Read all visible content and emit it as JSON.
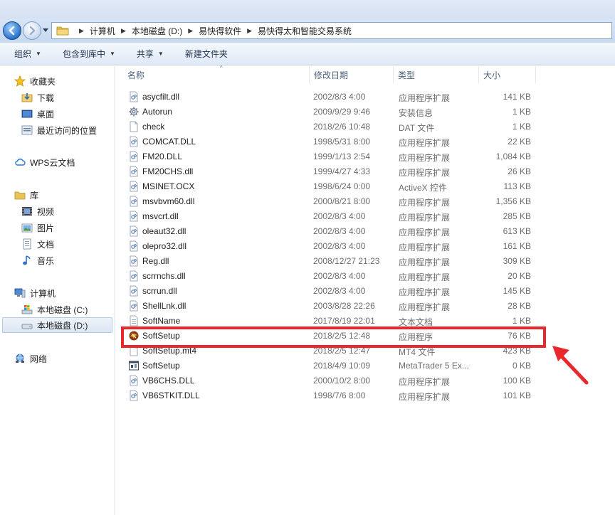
{
  "address": {
    "crumbs": [
      "计算机",
      "本地磁盘 (D:)",
      "易快得软件",
      "易快得太和智能交易系统"
    ]
  },
  "toolbar": {
    "organize": "组织",
    "include_library": "包含到库中",
    "share": "共享",
    "new_folder": "新建文件夹"
  },
  "sidebar": {
    "favorites": "收藏夹",
    "downloads": "下载",
    "desktop": "桌面",
    "recent": "最近访问的位置",
    "wps": "WPS云文档",
    "libraries": "库",
    "videos": "视频",
    "pictures": "图片",
    "documents": "文档",
    "music": "音乐",
    "computer": "计算机",
    "drive_c": "本地磁盘 (C:)",
    "drive_d": "本地磁盘 (D:)",
    "network": "网络"
  },
  "columns": {
    "name": "名称",
    "date": "修改日期",
    "type": "类型",
    "size": "大小"
  },
  "files": [
    {
      "name": "asycfilt.dll",
      "date": "2002/8/3 4:00",
      "type": "应用程序扩展",
      "size": "141 KB",
      "icon": "dll"
    },
    {
      "name": "Autorun",
      "date": "2009/9/29 9:46",
      "type": "安装信息",
      "size": "1 KB",
      "icon": "gear"
    },
    {
      "name": "check",
      "date": "2018/2/6 10:48",
      "type": "DAT 文件",
      "size": "1 KB",
      "icon": "blank"
    },
    {
      "name": "COMCAT.DLL",
      "date": "1998/5/31 8:00",
      "type": "应用程序扩展",
      "size": "22 KB",
      "icon": "dll"
    },
    {
      "name": "FM20.DLL",
      "date": "1999/1/13 2:54",
      "type": "应用程序扩展",
      "size": "1,084 KB",
      "icon": "dll"
    },
    {
      "name": "FM20CHS.dll",
      "date": "1999/4/27 4:33",
      "type": "应用程序扩展",
      "size": "26 KB",
      "icon": "dll"
    },
    {
      "name": "MSINET.OCX",
      "date": "1998/6/24 0:00",
      "type": "ActiveX 控件",
      "size": "113 KB",
      "icon": "dll"
    },
    {
      "name": "msvbvm60.dll",
      "date": "2000/8/21 8:00",
      "type": "应用程序扩展",
      "size": "1,356 KB",
      "icon": "dll"
    },
    {
      "name": "msvcrt.dll",
      "date": "2002/8/3 4:00",
      "type": "应用程序扩展",
      "size": "285 KB",
      "icon": "dll"
    },
    {
      "name": "oleaut32.dll",
      "date": "2002/8/3 4:00",
      "type": "应用程序扩展",
      "size": "613 KB",
      "icon": "dll"
    },
    {
      "name": "olepro32.dll",
      "date": "2002/8/3 4:00",
      "type": "应用程序扩展",
      "size": "161 KB",
      "icon": "dll"
    },
    {
      "name": "Reg.dll",
      "date": "2008/12/27 21:23",
      "type": "应用程序扩展",
      "size": "309 KB",
      "icon": "dll"
    },
    {
      "name": "scrrnchs.dll",
      "date": "2002/8/3 4:00",
      "type": "应用程序扩展",
      "size": "20 KB",
      "icon": "dll"
    },
    {
      "name": "scrrun.dll",
      "date": "2002/8/3 4:00",
      "type": "应用程序扩展",
      "size": "145 KB",
      "icon": "dll"
    },
    {
      "name": "ShellLnk.dll",
      "date": "2003/8/28 22:26",
      "type": "应用程序扩展",
      "size": "28 KB",
      "icon": "dll"
    },
    {
      "name": "SoftName",
      "date": "2017/8/19 22:01",
      "type": "文本文档",
      "size": "1 KB",
      "icon": "txt"
    },
    {
      "name": "SoftSetup",
      "date": "2018/2/5 12:48",
      "type": "应用程序",
      "size": "76 KB",
      "icon": "app"
    },
    {
      "name": "SoftSetup.mt4",
      "date": "2018/2/5 12:47",
      "type": "MT4 文件",
      "size": "423 KB",
      "icon": "blank"
    },
    {
      "name": "SoftSetup",
      "date": "2018/4/9 10:09",
      "type": "MetaTrader 5 Ex...",
      "size": "0 KB",
      "icon": "mt5"
    },
    {
      "name": "VB6CHS.DLL",
      "date": "2000/10/2 8:00",
      "type": "应用程序扩展",
      "size": "100 KB",
      "icon": "dll"
    },
    {
      "name": "VB6STKIT.DLL",
      "date": "1998/7/6 8:00",
      "type": "应用程序扩展",
      "size": "101 KB",
      "icon": "dll"
    }
  ],
  "colors": {
    "highlight": "#e8282d",
    "toolbar_text": "#1e2f4a",
    "column_header": "#4c607a"
  }
}
